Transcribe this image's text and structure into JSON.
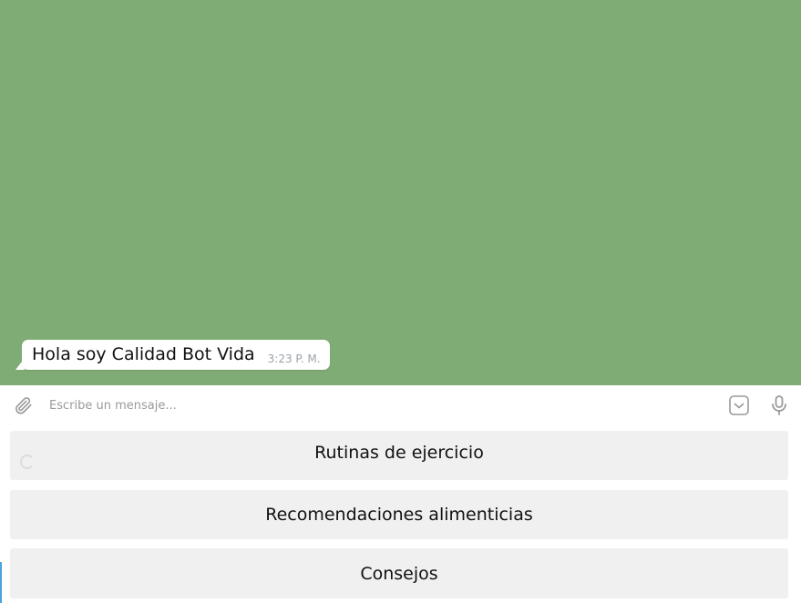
{
  "chat": {
    "background_color": "#7fab74",
    "messages": [
      {
        "text": "Hola soy Calidad Bot Vida",
        "time": "3:23 P. M."
      }
    ]
  },
  "composer": {
    "placeholder": "Escribe un mensaje...",
    "value": "",
    "attach_icon": "paperclip-icon",
    "emoji_icon": "sticker-icon",
    "mic_icon": "microphone-icon"
  },
  "keyboard": {
    "buttons": [
      {
        "label": "Rutinas de ejercicio"
      },
      {
        "label": "Recomendaciones alimenticias"
      },
      {
        "label": "Consejos"
      }
    ]
  }
}
